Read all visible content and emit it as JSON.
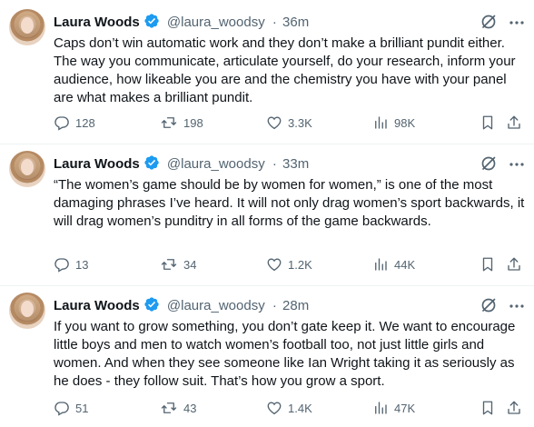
{
  "tweets": [
    {
      "author": "Laura Woods",
      "handle": "@laura_woodsy",
      "time": "36m",
      "text": "Caps don’t win automatic work and they don’t make a brilliant pundit either. The way you communicate, articulate yourself, do your research, inform your audience, how likeable you are and the chemistry you have with your panel are what makes a brilliant pundit.",
      "replies": "128",
      "retweets": "198",
      "likes": "3.3K",
      "views": "98K"
    },
    {
      "author": "Laura Woods",
      "handle": "@laura_woodsy",
      "time": "33m",
      "text": "“The women’s game should be by women for women,” is one of the most damaging phrases I’ve heard. It will not only drag women’s sport backwards, it will drag women’s punditry in all forms of the game backwards.",
      "replies": "13",
      "retweets": "34",
      "likes": "1.2K",
      "views": "44K"
    },
    {
      "author": "Laura Woods",
      "handle": "@laura_woodsy",
      "time": "28m",
      "text": "If you want to grow something, you don’t gate keep it. We want to encourage little boys and men to watch women’s football too, not just little girls and women. And when they see someone like Ian Wright taking it as seriously as he does - they follow suit. That’s how you grow a sport.",
      "replies": "51",
      "retweets": "43",
      "likes": "1.4K",
      "views": "47K"
    }
  ],
  "separator": "·",
  "colors": {
    "text": "#0f1419",
    "secondary": "#536471",
    "verified": "#1d9bf0",
    "divider": "#eff3f4"
  }
}
